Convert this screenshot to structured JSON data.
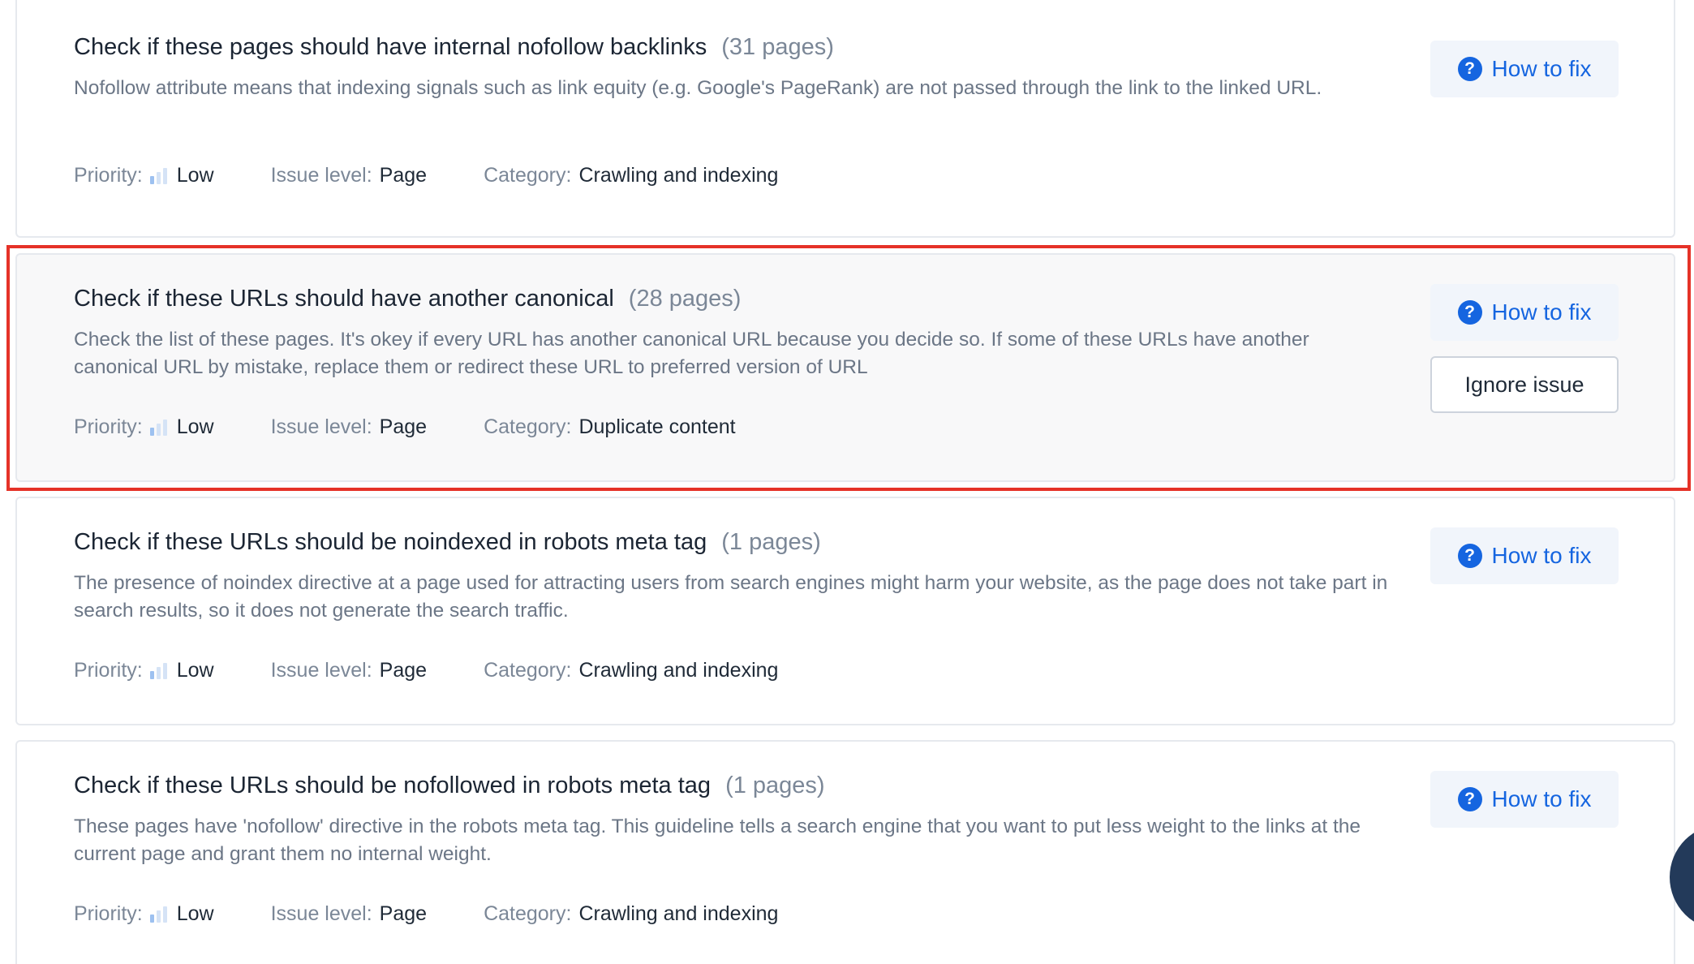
{
  "issues": [
    {
      "title": "Check if these pages should have internal nofollow backlinks",
      "count": "(31 pages)",
      "description": "Nofollow attribute means that indexing signals such as link equity (e.g. Google's PageRank) are not passed through the link to the linked URL.",
      "priority_label": "Priority:",
      "priority": "Low",
      "level_label": "Issue level:",
      "level": "Page",
      "category_label": "Category:",
      "category": "Crawling and indexing",
      "how_to_fix": "How to fix"
    },
    {
      "title": "Check if these URLs should have another canonical",
      "count": "(28 pages)",
      "description": "Check the list of these pages. It's okey if every URL has another canonical URL because you decide so. If some of these URLs have another canonical URL by mistake, replace them or redirect these URL to preferred version of URL",
      "priority_label": "Priority:",
      "priority": "Low",
      "level_label": "Issue level:",
      "level": "Page",
      "category_label": "Category:",
      "category": "Duplicate content",
      "how_to_fix": "How to fix",
      "ignore": "Ignore issue"
    },
    {
      "title": "Check if these URLs should be noindexed in robots meta tag",
      "count": "(1 pages)",
      "description": "The presence of noindex directive at a page used for attracting users from search engines might harm your website, as the page does not take part in search results, so it does not generate the search traffic.",
      "priority_label": "Priority:",
      "priority": "Low",
      "level_label": "Issue level:",
      "level": "Page",
      "category_label": "Category:",
      "category": "Crawling and indexing",
      "how_to_fix": "How to fix"
    },
    {
      "title": "Check if these URLs should be nofollowed in robots meta tag",
      "count": "(1 pages)",
      "description": "These pages have 'nofollow' directive in the robots meta tag. This guideline tells a search engine that you want to put less weight to the links at the current page and grant them no internal weight.",
      "priority_label": "Priority:",
      "priority": "Low",
      "level_label": "Issue level:",
      "level": "Page",
      "category_label": "Category:",
      "category": "Crawling and indexing",
      "how_to_fix": "How to fix"
    }
  ],
  "help_glyph": "?",
  "colors": {
    "accent": "#1565e0",
    "highlight_border": "#e53228",
    "card_border": "#e6e9ee",
    "muted_text": "#7b8797"
  },
  "icons": {
    "help": "question-circle-icon",
    "priority": "signal-bars-icon"
  }
}
